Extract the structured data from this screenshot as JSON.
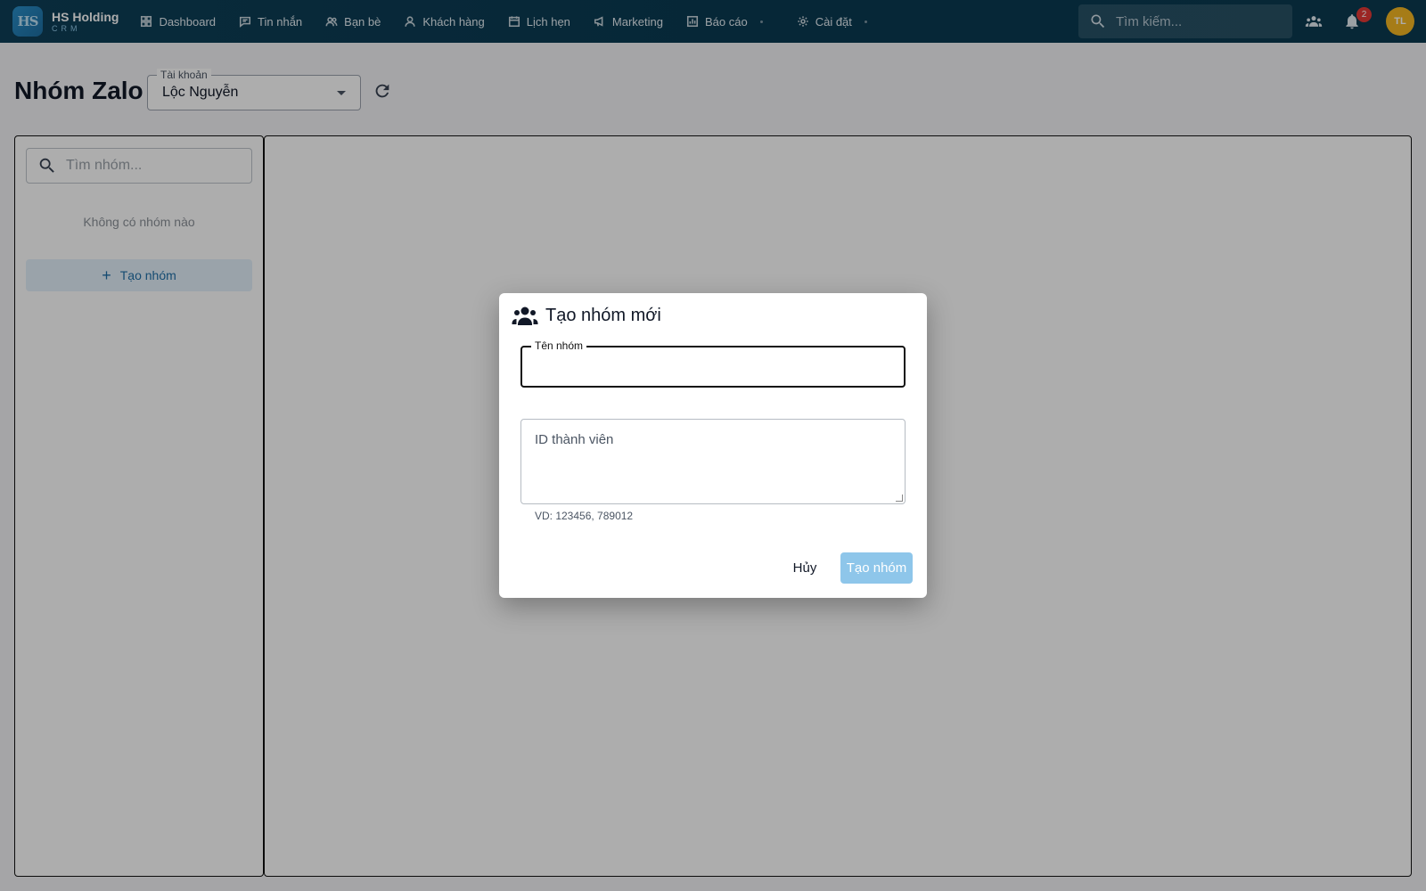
{
  "brand": {
    "logo": "HS",
    "name": "HS Holding",
    "sub": "CRM"
  },
  "nav": [
    {
      "label": "Dashboard",
      "icon": "dashboard-icon"
    },
    {
      "label": "Tin nhắn",
      "icon": "message-icon"
    },
    {
      "label": "Bạn bè",
      "icon": "friends-icon"
    },
    {
      "label": "Khách hàng",
      "icon": "customer-icon"
    },
    {
      "label": "Lịch hẹn",
      "icon": "calendar-icon"
    },
    {
      "label": "Marketing",
      "icon": "megaphone-icon"
    },
    {
      "label": "Báo cáo",
      "icon": "report-icon"
    },
    {
      "label": "Cài đặt",
      "icon": "gear-icon"
    }
  ],
  "topbar": {
    "search_placeholder": "Tìm kiếm...",
    "notification_count": "2",
    "avatar_initials": "TL"
  },
  "page": {
    "title": "Nhóm Zalo",
    "account_label": "Tài khoản",
    "account_value": "Lộc Nguyễn"
  },
  "sidebar": {
    "search_placeholder": "Tìm nhóm...",
    "empty_text": "Không có nhóm nào",
    "create_label": "Tạo nhóm"
  },
  "dialog": {
    "title": "Tạo nhóm mới",
    "name_label": "Tên nhóm",
    "name_value": "",
    "ids_placeholder": "ID thành viên",
    "helper": "VD: 123456, 789012",
    "cancel_label": "Hủy",
    "submit_label": "Tạo nhóm"
  },
  "colors": {
    "topbar": "#0e3f57",
    "accent": "#1f6fa8",
    "submit_disabled": "#8ec6ea",
    "badge": "#e53935",
    "avatar": "#f5b722"
  }
}
